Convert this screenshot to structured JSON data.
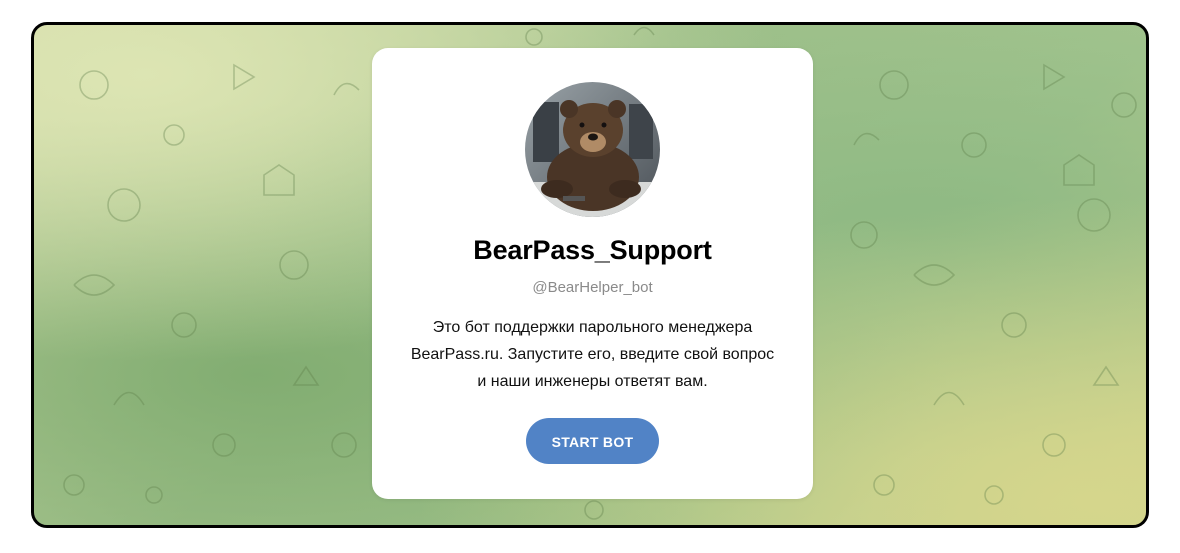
{
  "bot": {
    "display_name": "BearPass_Support",
    "username": "@BearHelper_bot",
    "description_lines": [
      "Это бот поддержки парольного менеджера",
      "BearPass.ru. Запустите его, введите свой вопрос",
      "и наши инженеры ответят вам."
    ],
    "avatar_icon": "bear-avatar"
  },
  "actions": {
    "start_label": "START BOT"
  },
  "colors": {
    "accent": "#5183c6",
    "background_green": "#a2c48e",
    "background_yellow": "#cdd38e",
    "card": "#ffffff"
  }
}
